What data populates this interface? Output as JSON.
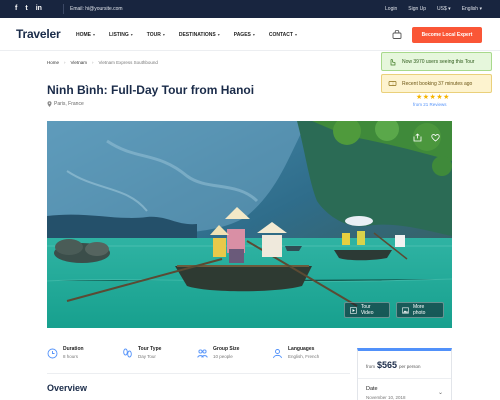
{
  "topbar": {
    "social": [
      "f",
      "t",
      "in"
    ],
    "email": "Email: hi@yoursite.com",
    "links": [
      "Login",
      "Sign Up",
      "US$",
      "English"
    ]
  },
  "header": {
    "logo": "Traveler",
    "nav": [
      "HOME",
      "LISTING",
      "TOUR",
      "DESTINATIONS",
      "PAGES",
      "CONTACT"
    ],
    "cta": "Become Local Expert"
  },
  "breadcrumb": [
    "Home",
    "Vietnam",
    "Vietnam Express Southbound"
  ],
  "toasts": {
    "viewing": "Now 3970 users seeing this Tour",
    "booking": "Recent booking 37 minutes ago"
  },
  "tour": {
    "title": "Ninh Bình: Full-Day Tour from Hanoi",
    "location": "Paris, France",
    "rating_stars": "★★★★★",
    "reviews": "from 21 Reviews",
    "tour_video": "Tour Video",
    "more_photo": "More photo"
  },
  "info": [
    {
      "label": "Duration",
      "value": "8 hours"
    },
    {
      "label": "Tour Type",
      "value": "Day Tour"
    },
    {
      "label": "Group Size",
      "value": "10 people"
    },
    {
      "label": "Languages",
      "value": "English, French"
    }
  ],
  "overview": "Overview",
  "booking": {
    "from": "from",
    "price": "$565",
    "per": "per person",
    "date_label": "Date",
    "date_value": "November 10, 2018"
  },
  "colors": {
    "topbar": "#18253f",
    "accent": "#fa5636",
    "link": "#5191fa",
    "title": "#1a2b49"
  }
}
